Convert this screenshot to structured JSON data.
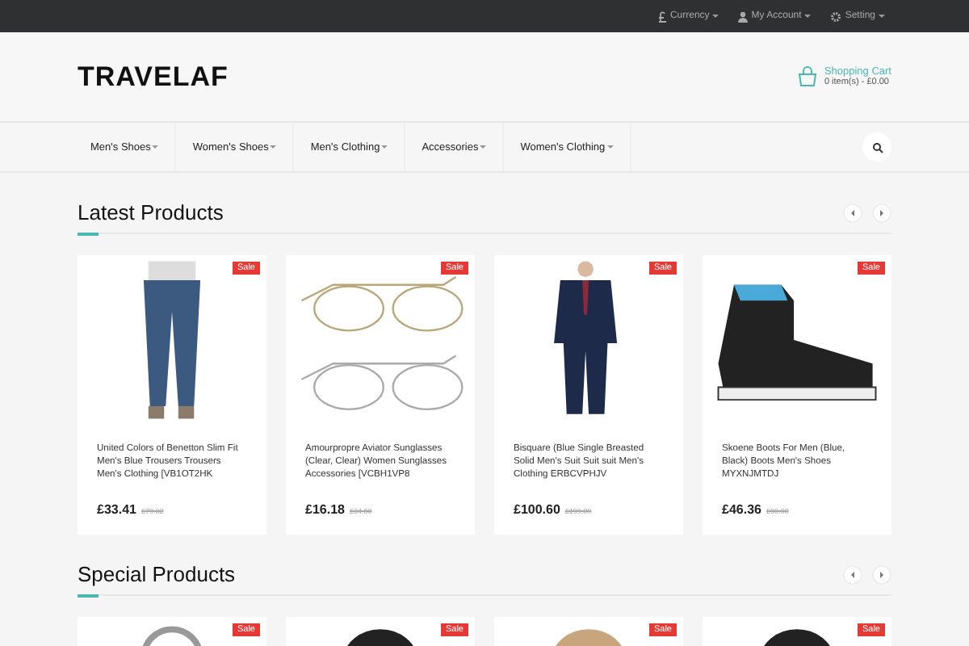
{
  "top_bar": {
    "links": [
      {
        "label": "Currency"
      },
      {
        "label": "My Account"
      },
      {
        "label": "Setting"
      }
    ]
  },
  "header": {
    "logo": "TRAVELAF",
    "cart": {
      "title": "Shopping Cart",
      "summary": "0 item(s) - £0.00"
    }
  },
  "nav": {
    "items": [
      "Men's Shoes",
      "Women's Shoes",
      "Men's Clothing",
      "Accessories",
      "Women's Clothing"
    ]
  },
  "sections": [
    {
      "title": "Latest Products",
      "products": [
        {
          "badge": "Sale",
          "name": "United Colors of Benetton Slim Fit Men's Blue Trousers Trousers Men's Clothing [VB1OT2HK",
          "price": "£33.41",
          "old_price": "£79.82"
        },
        {
          "badge": "Sale",
          "name": "Amourpropre Aviator Sunglasses (Clear, Clear) Women Sunglasses Accessories [VCBH1VP8",
          "price": "£16.18",
          "old_price": "£34.00"
        },
        {
          "badge": "Sale",
          "name": "Bisquare (Blue Single Breasted Solid Men's Suit Suit suit Men's Clothing ERBCVPHJV",
          "price": "£100.60",
          "old_price": "£199.00"
        },
        {
          "badge": "Sale",
          "name": "Skoene Boots For Men (Blue, Black) Boots Men's Shoes MYXNJMTDJ",
          "price": "£46.36",
          "old_price": "£90.00"
        }
      ]
    },
    {
      "title": "Special Products",
      "products": [
        {
          "badge": "Sale"
        },
        {
          "badge": "Sale"
        },
        {
          "badge": "Sale"
        },
        {
          "badge": "Sale"
        }
      ]
    }
  ]
}
